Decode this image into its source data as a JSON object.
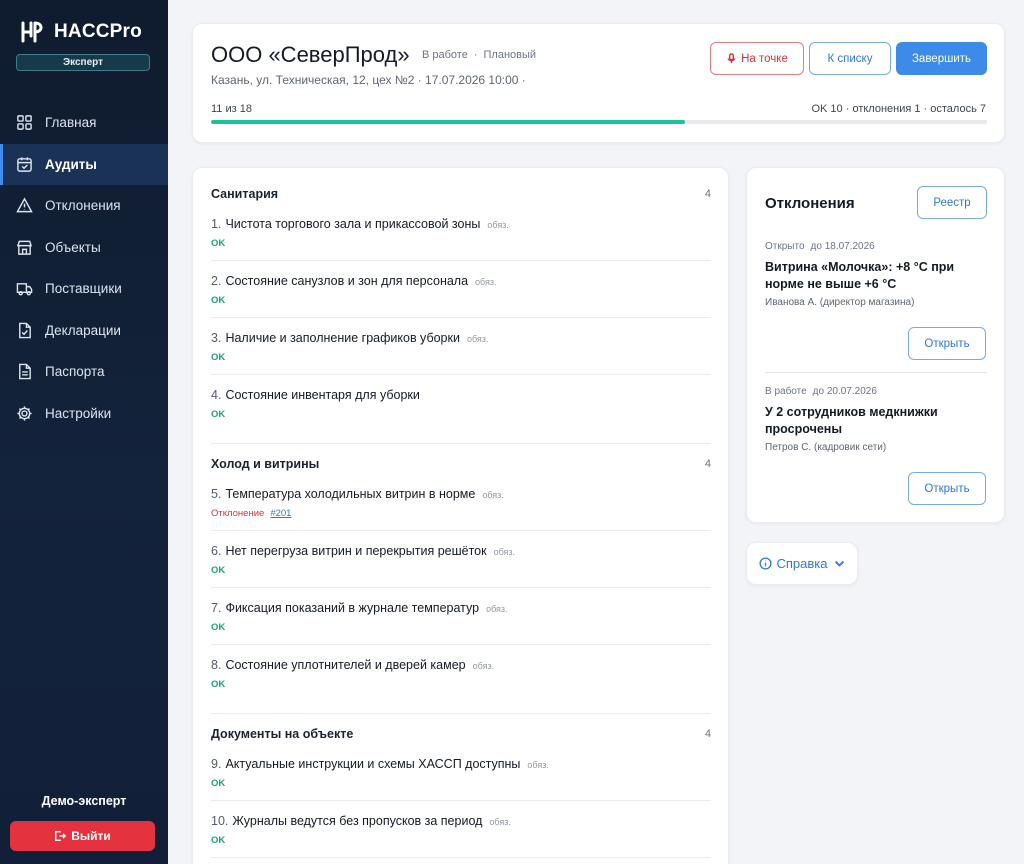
{
  "app": {
    "name": "HACCPro",
    "role": "Эксперт"
  },
  "nav": [
    {
      "label": "Главная",
      "icon": "grid-icon",
      "active": false
    },
    {
      "label": "Аудиты",
      "icon": "calendar-check-icon",
      "active": true
    },
    {
      "label": "Отклонения",
      "icon": "warning-icon",
      "active": false
    },
    {
      "label": "Объекты",
      "icon": "store-icon",
      "active": false
    },
    {
      "label": "Поставщики",
      "icon": "truck-icon",
      "active": false
    },
    {
      "label": "Декларации",
      "icon": "document-check-icon",
      "active": false
    },
    {
      "label": "Паспорта",
      "icon": "document-icon",
      "active": false
    },
    {
      "label": "Настройки",
      "icon": "gear-icon",
      "active": false
    }
  ],
  "user": {
    "name": "Демо-эксперт",
    "logout_label": "Выйти"
  },
  "audit": {
    "title": "ООО «СеверПрод»",
    "status": "В работе",
    "separator": "·",
    "type": "Плановый",
    "subtitle": "Казань, ул. Техническая, 12, цех №2 · 17.07.2026 10:00 ·",
    "btn_onsite": "На точке",
    "btn_list": "К списку",
    "btn_finish": "Завершить",
    "progress_text": "11 из 18",
    "progress_summary": "OK 10 · отклонения 1 · осталось 7",
    "progress_fraction": 0.611
  },
  "checklist": {
    "sections": [
      {
        "title": "Санитария",
        "count": "4",
        "items": [
          {
            "num": "1.",
            "text": "Чистота торгового зала и прикассовой зоны",
            "req": "обяз.",
            "status": "OK"
          },
          {
            "num": "2.",
            "text": "Состояние санузлов и зон для персонала",
            "req": "обяз.",
            "status": "OK"
          },
          {
            "num": "3.",
            "text": "Наличие и заполнение графиков уборки",
            "req": "обяз.",
            "status": "OK"
          },
          {
            "num": "4.",
            "text": "Состояние инвентаря для уборки",
            "req": "",
            "status": "OK"
          }
        ]
      },
      {
        "title": "Холод и витрины",
        "count": "4",
        "items": [
          {
            "num": "5.",
            "text": "Температура холодильных витрин в норме",
            "req": "обяз.",
            "status": "Отклонение",
            "link": "#201"
          },
          {
            "num": "6.",
            "text": "Нет перегруза витрин и перекрытия решёток",
            "req": "обяз.",
            "status": "OK"
          },
          {
            "num": "7.",
            "text": "Фиксация показаний в журнале температур",
            "req": "обяз.",
            "status": "OK"
          },
          {
            "num": "8.",
            "text": "Состояние уплотнителей и дверей камер",
            "req": "обяз.",
            "status": "OK"
          }
        ]
      },
      {
        "title": "Документы на объекте",
        "count": "4",
        "items": [
          {
            "num": "9.",
            "text": "Актуальные инструкции и схемы ХАССП доступны",
            "req": "обяз.",
            "status": "OK"
          },
          {
            "num": "10.",
            "text": "Журналы ведутся без пропусков за период",
            "req": "обяз.",
            "status": "OK"
          }
        ]
      }
    ]
  },
  "deviations": {
    "title": "Отклонения",
    "registry_label": "Реестр",
    "items": [
      {
        "state": "Открыто",
        "due": "до 18.07.2026",
        "title": "Витрина «Молочка»: +8 °C при норме не выше +6 °C",
        "responsible": "Иванова А. (директор магазина)",
        "open_label": "Открыть"
      },
      {
        "state": "В работе",
        "due": "до 20.07.2026",
        "title": "У 2 сотрудников медкнижки просрочены",
        "responsible": "Петров С. (кадровик сети)",
        "open_label": "Открыть"
      }
    ]
  },
  "help": {
    "label": "Справка"
  },
  "colors": {
    "accent": "#3d8be8",
    "ok": "#1ea36f",
    "danger": "#d6323f",
    "progress": "#1ec198",
    "sidebar": "#0f1b2e"
  }
}
